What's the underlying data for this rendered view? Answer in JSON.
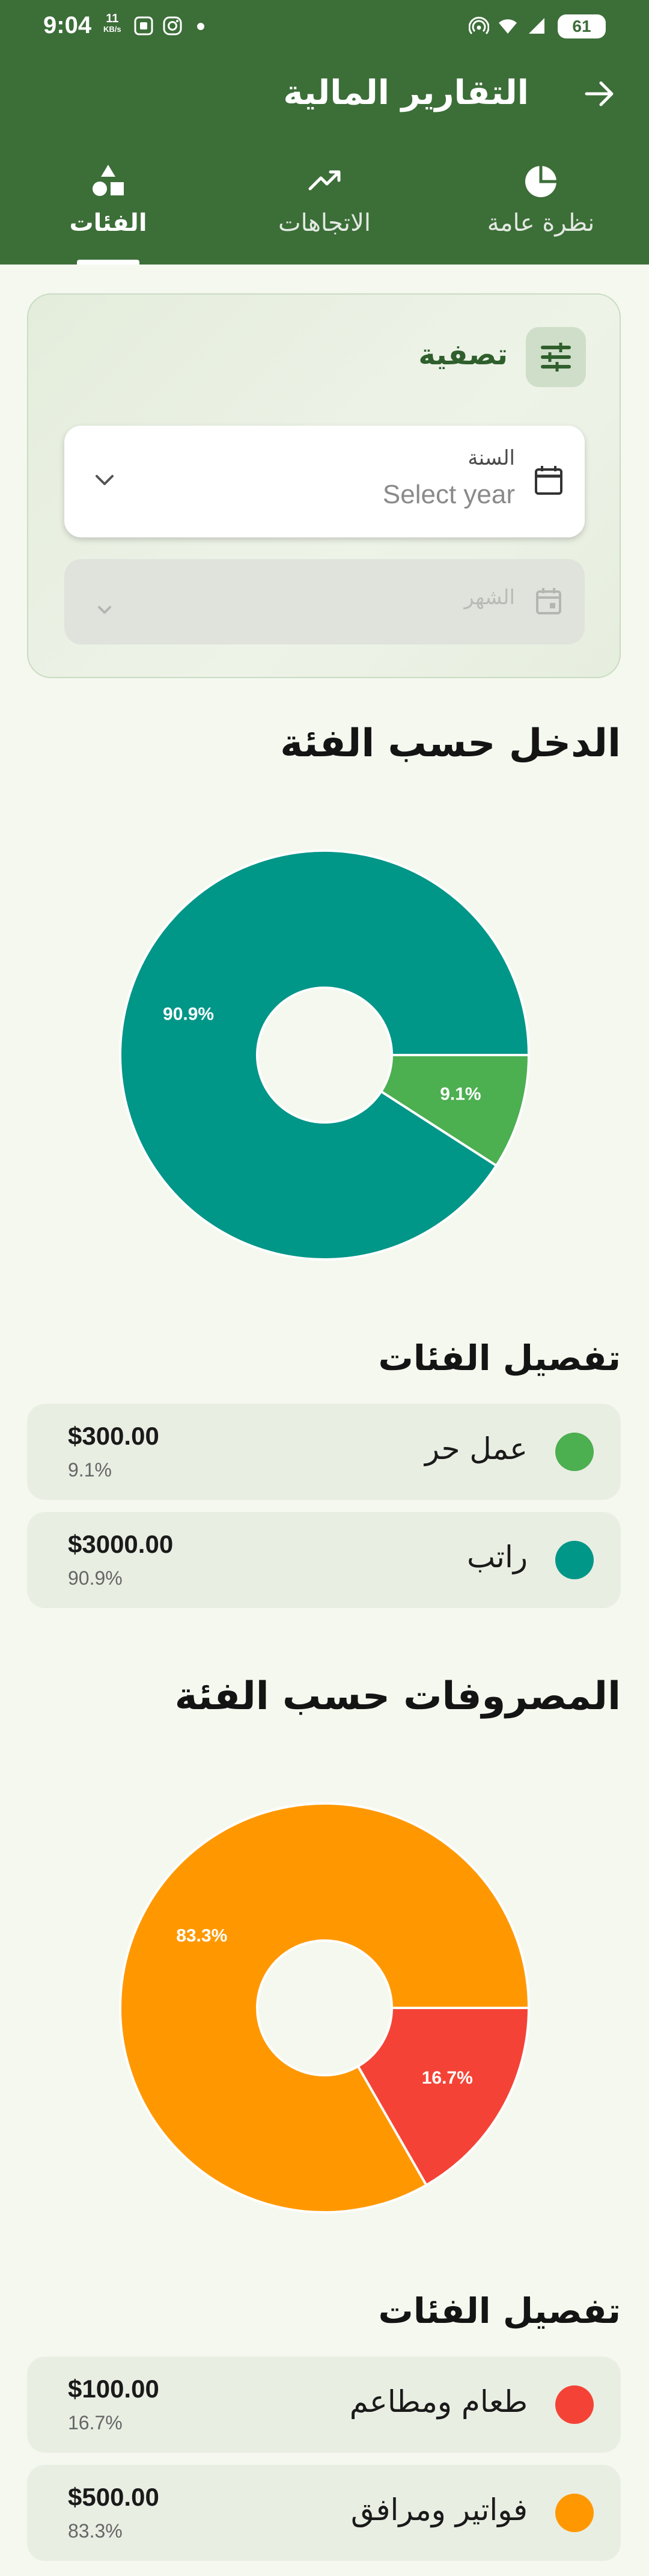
{
  "status": {
    "time": "9:04",
    "net_speed": "11",
    "net_unit": "KB/s",
    "battery": "61"
  },
  "header": {
    "title": "التقارير المالية"
  },
  "tabs": [
    {
      "label": "نظرة عامة",
      "icon": "pie-chart-icon",
      "active": false
    },
    {
      "label": "الاتجاهات",
      "icon": "trending-icon",
      "active": false
    },
    {
      "label": "الفئات",
      "icon": "category-shapes-icon",
      "active": true
    }
  ],
  "filter": {
    "title": "تصفية",
    "year_label": "السنة",
    "year_placeholder": "Select year",
    "month_label": "الشهر"
  },
  "income": {
    "title": "الدخل حسب الفئة",
    "breakdown_title": "تفصيل الفئات",
    "items": [
      {
        "name": "عمل حر",
        "amount": "$300.00",
        "percent": "9.1%",
        "color": "#4caf50"
      },
      {
        "name": "راتب",
        "amount": "$3000.00",
        "percent": "90.9%",
        "color": "#009688"
      }
    ]
  },
  "expenses": {
    "title": "المصروفات حسب الفئة",
    "breakdown_title": "تفصيل الفئات",
    "items": [
      {
        "name": "طعام ومطاعم",
        "amount": "$100.00",
        "percent": "16.7%",
        "color": "#f44336"
      },
      {
        "name": "فواتير ومرافق",
        "amount": "$500.00",
        "percent": "83.3%",
        "color": "#ff9800"
      }
    ]
  },
  "chart_data": [
    {
      "type": "pie",
      "title": "الدخل حسب الفئة",
      "categories": [
        "عمل حر",
        "راتب"
      ],
      "values": [
        9.1,
        90.9
      ],
      "colors": [
        "#4caf50",
        "#009688"
      ],
      "labels": [
        "9.1%",
        "90.9%"
      ],
      "donut": true
    },
    {
      "type": "pie",
      "title": "المصروفات حسب الفئة",
      "categories": [
        "طعام ومطاعم",
        "فواتير ومرافق"
      ],
      "values": [
        16.7,
        83.3
      ],
      "colors": [
        "#f44336",
        "#ff9800"
      ],
      "labels": [
        "16.7%",
        "83.3%"
      ],
      "donut": true
    }
  ]
}
